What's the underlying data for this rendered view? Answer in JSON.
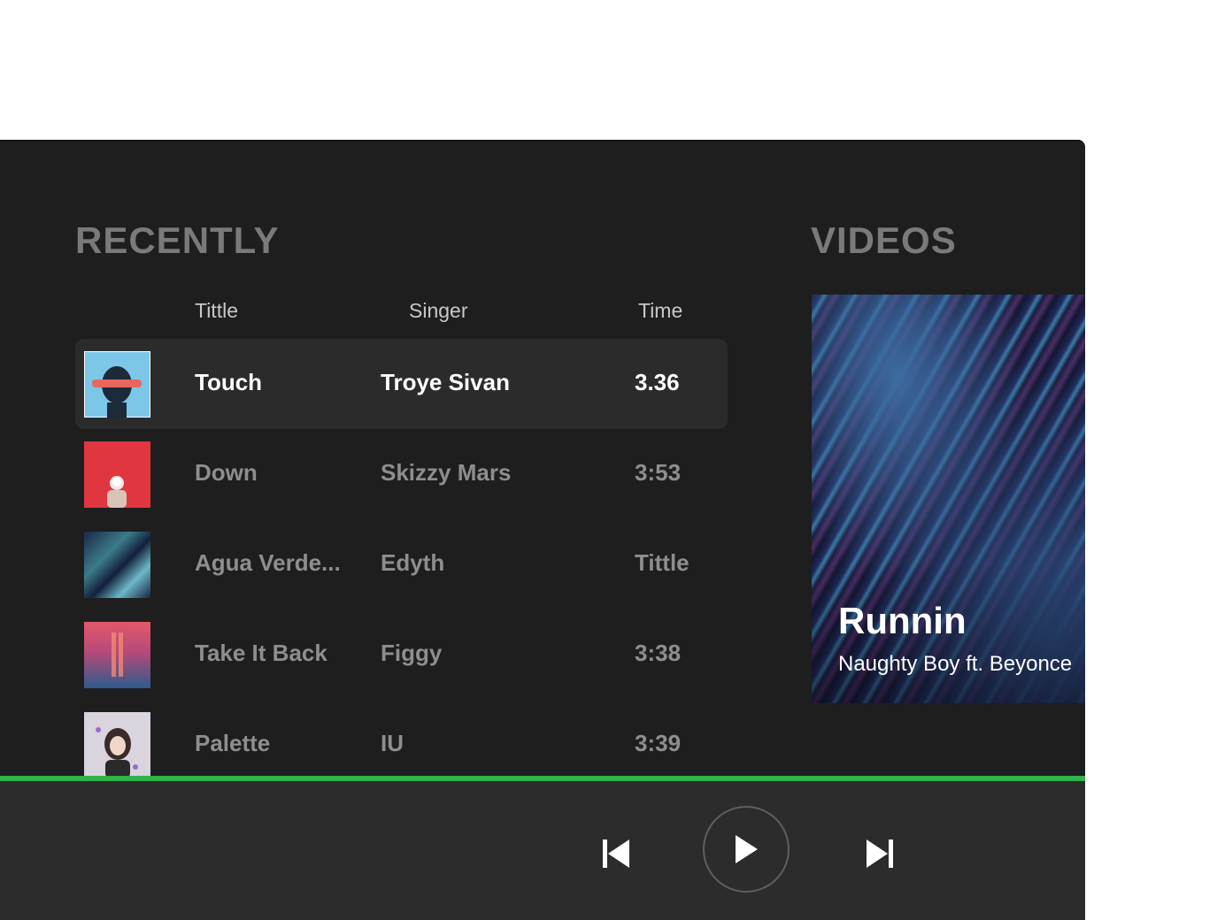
{
  "sections": {
    "recently": "RECENTLY",
    "videos": "VIDEOS"
  },
  "columns": {
    "title": "Tittle",
    "singer": "Singer",
    "time": "Time"
  },
  "tracks": [
    {
      "title": "Touch",
      "singer": "Troye Sivan",
      "time": "3.36",
      "active": true
    },
    {
      "title": "Down",
      "singer": "Skizzy Mars",
      "time": "3:53",
      "active": false
    },
    {
      "title": "Agua Verde...",
      "singer": "Edyth",
      "time": "Tittle",
      "active": false
    },
    {
      "title": "Take It Back",
      "singer": "Figgy",
      "time": "3:38",
      "active": false
    },
    {
      "title": "Palette",
      "singer": "IU",
      "time": "3:39",
      "active": false
    }
  ],
  "video": {
    "title": "Runnin",
    "artist": "Naughty Boy ft. Beyonce"
  },
  "player": {
    "progress": 1.0,
    "controls": [
      "previous-track-icon",
      "play-icon",
      "next-track-icon"
    ]
  },
  "colors": {
    "background": "#1e1e1e",
    "player_bar": "#2c2c2c",
    "active_row": "#2b2b2b",
    "accent": "#2fb34a",
    "muted_text": "#8e8e8e",
    "section_title": "#7a7a7a"
  }
}
